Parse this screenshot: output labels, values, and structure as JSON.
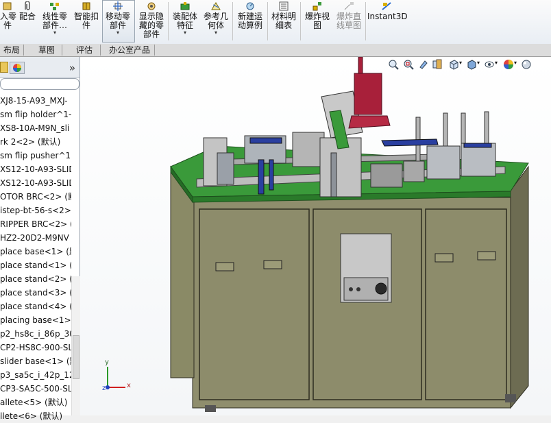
{
  "ribbon": {
    "buttons": [
      {
        "id": "insert-part",
        "label": "入零\n件",
        "icon": "insert-part-icon",
        "dropdown": false
      },
      {
        "id": "mate",
        "label": "配合",
        "icon": "paperclip-icon",
        "dropdown": false
      },
      {
        "id": "linear-pattern",
        "label": "线性零\n部件…",
        "icon": "linear-pattern-icon",
        "dropdown": true
      },
      {
        "id": "smart-fasteners",
        "label": "智能扣\n件",
        "icon": "smart-fasteners-icon",
        "dropdown": false
      },
      {
        "id": "move-component",
        "label": "移动零\n部件",
        "icon": "move-component-icon",
        "dropdown": true
      },
      {
        "id": "show-hidden",
        "label": "显示隐\n藏的零\n部件",
        "icon": "show-hidden-icon",
        "dropdown": false
      },
      {
        "id": "assembly-features",
        "label": "装配体\n特征",
        "icon": "assembly-feature-icon",
        "dropdown": true
      },
      {
        "id": "reference-geometry",
        "label": "参考几\n何体",
        "icon": "reference-geometry-icon",
        "dropdown": true
      },
      {
        "id": "new-motion-study",
        "label": "新建运\n动算例",
        "icon": "motion-study-icon",
        "dropdown": false
      },
      {
        "id": "bom",
        "label": "材料明\n细表",
        "icon": "bom-icon",
        "dropdown": false
      },
      {
        "id": "exploded-view",
        "label": "爆炸视\n图",
        "icon": "exploded-view-icon",
        "dropdown": false
      },
      {
        "id": "explode-line-sketch",
        "label": "爆炸直\n线草图",
        "icon": "explode-line-icon",
        "dropdown": false,
        "disabled": true
      },
      {
        "id": "instant3d",
        "label": "Instant3D",
        "icon": "instant3d-icon",
        "dropdown": false
      }
    ]
  },
  "tabs": [
    "布局",
    "草图",
    "评估",
    "办公室产品"
  ],
  "panel": {
    "collapse_symbol": "»",
    "tree_items": [
      "XJ8-15-A93_MXJ-",
      "sm flip holder^1-",
      "XS8-10A-M9N_sli",
      "rk 2<2> (默认)",
      "sm flip pusher^1",
      "XS12-10-A93-SLID",
      "XS12-10-A93-SLID",
      "OTOR BRC<2> (默",
      "istep-bt-56-s<2>",
      "RIPPER BRC<2> (默",
      "HZ2-20D2-M9NV",
      "place base<1> (默",
      "place stand<1> (",
      "place stand<2> (",
      "place stand<3> (",
      "place stand<4> (",
      "placing base<1>",
      "p2_hs8c_i_86p_30_",
      "CP2-HS8C-900-SLI",
      "slider base<1> (默",
      "p3_sa5c_i_42p_12_",
      "CP3-SA5C-500-SLI",
      "allete<5> (默认)",
      "llete<6> (默认)"
    ]
  },
  "viewport": {
    "triad": {
      "x": "x",
      "y": "y",
      "z": "z"
    },
    "view_icons": [
      "zoom-to-fit-icon",
      "zoom-to-area-icon",
      "previous-view-icon",
      "section-view-icon",
      "view-orientation-icon",
      "display-style-icon",
      "hide-show-items-icon",
      "appearance-icon",
      "scene-icon"
    ],
    "colors": {
      "table_top": "#3a9a3a",
      "cabinet": "#8f8e6d",
      "frame": "#bdbdbd",
      "gripper": "#a8203a",
      "accent_blue": "#2a3fa0"
    }
  }
}
